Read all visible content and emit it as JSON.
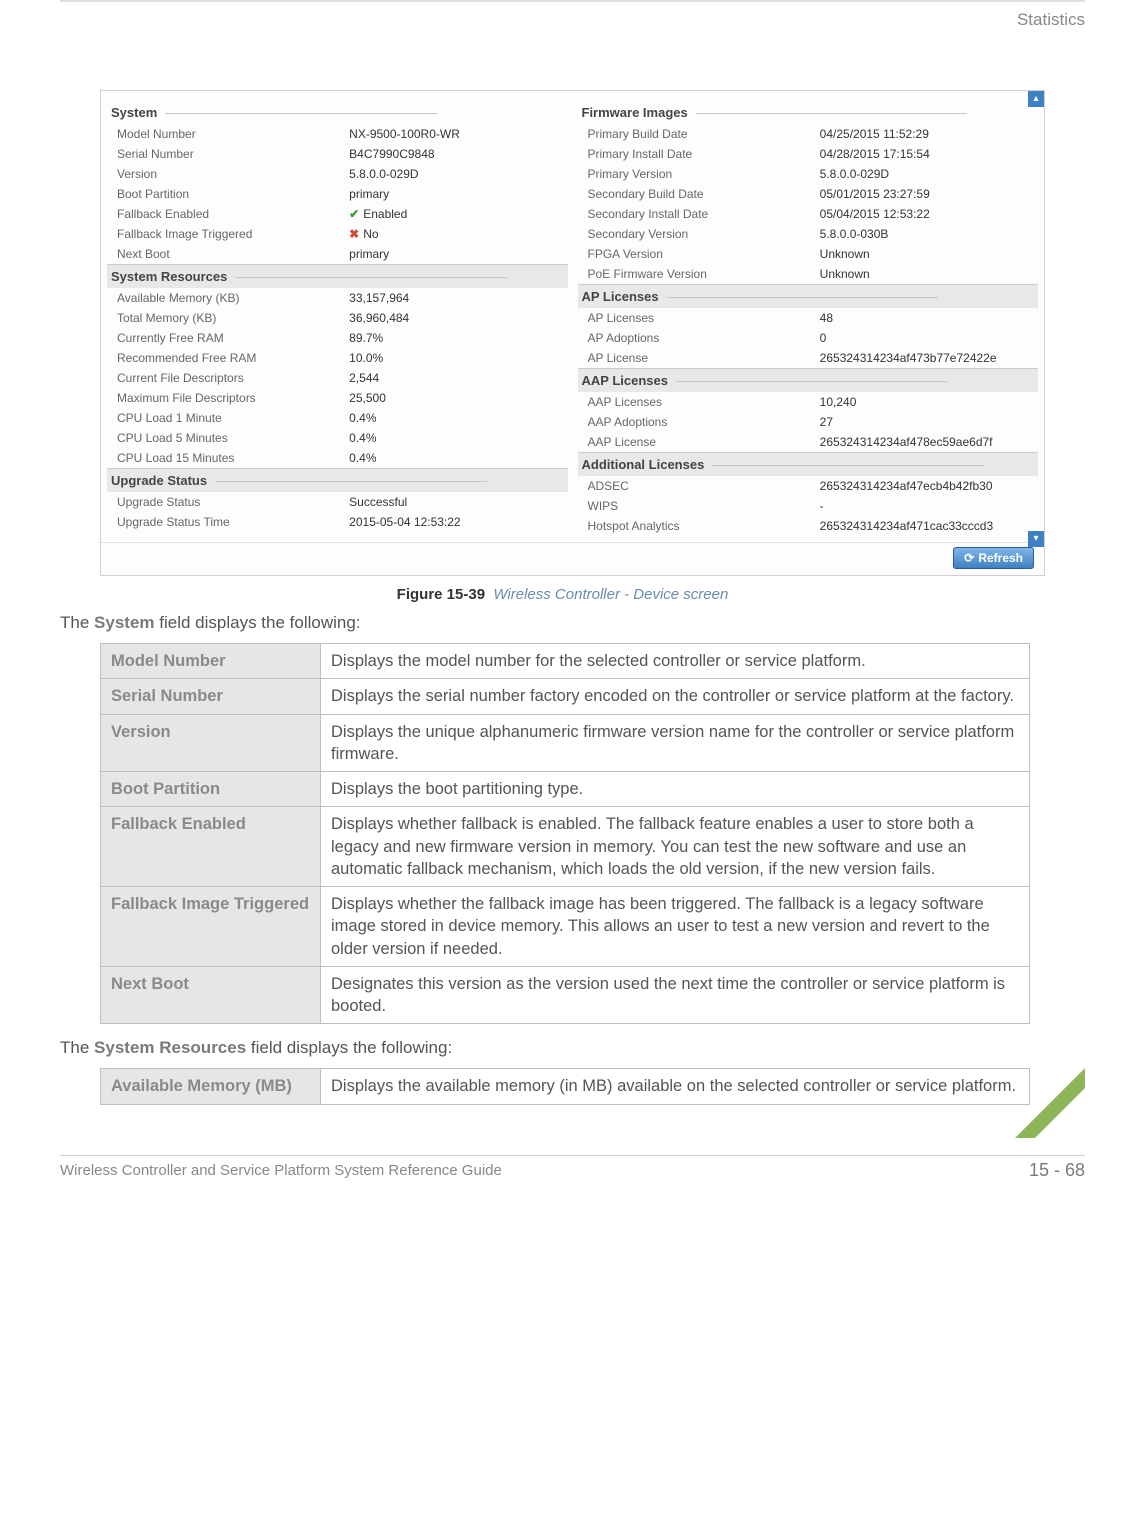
{
  "header": {
    "breadcrumb": "Statistics"
  },
  "screenshot": {
    "left": {
      "system": {
        "title": "System",
        "rows": [
          {
            "k": "Model Number",
            "v": "NX-9500-100R0-WR"
          },
          {
            "k": "Serial Number",
            "v": "B4C7990C9848"
          },
          {
            "k": "Version",
            "v": "5.8.0.0-029D"
          },
          {
            "k": "Boot Partition",
            "v": "primary"
          },
          {
            "k": "Fallback Enabled",
            "v": "Enabled",
            "icon": "check"
          },
          {
            "k": "Fallback Image Triggered",
            "v": "No",
            "icon": "x"
          },
          {
            "k": "Next Boot",
            "v": "primary"
          }
        ]
      },
      "resources": {
        "title": "System Resources",
        "rows": [
          {
            "k": "Available Memory (KB)",
            "v": "33,157,964"
          },
          {
            "k": "Total Memory (KB)",
            "v": "36,960,484"
          },
          {
            "k": "Currently Free RAM",
            "v": "89.7%"
          },
          {
            "k": "Recommended Free RAM",
            "v": "10.0%"
          },
          {
            "k": "Current File Descriptors",
            "v": "2,544"
          },
          {
            "k": "Maximum File Descriptors",
            "v": "25,500"
          },
          {
            "k": "CPU Load 1 Minute",
            "v": "0.4%"
          },
          {
            "k": "CPU Load 5 Minutes",
            "v": "0.4%"
          },
          {
            "k": "CPU Load 15 Minutes",
            "v": "0.4%"
          }
        ]
      },
      "upgrade": {
        "title": "Upgrade Status",
        "rows": [
          {
            "k": "Upgrade Status",
            "v": "Successful"
          },
          {
            "k": "Upgrade Status Time",
            "v": "2015-05-04 12:53:22"
          }
        ]
      }
    },
    "right": {
      "firmware": {
        "title": "Firmware Images",
        "rows": [
          {
            "k": "Primary Build Date",
            "v": "04/25/2015 11:52:29"
          },
          {
            "k": "Primary Install Date",
            "v": "04/28/2015 17:15:54"
          },
          {
            "k": "Primary Version",
            "v": "5.8.0.0-029D"
          },
          {
            "k": "Secondary Build Date",
            "v": "05/01/2015 23:27:59"
          },
          {
            "k": "Secondary Install Date",
            "v": "05/04/2015 12:53:22"
          },
          {
            "k": "Secondary Version",
            "v": "5.8.0.0-030B"
          },
          {
            "k": "FPGA Version",
            "v": "Unknown"
          },
          {
            "k": "PoE Firmware Version",
            "v": "Unknown"
          }
        ]
      },
      "ap": {
        "title": "AP Licenses",
        "rows": [
          {
            "k": "AP Licenses",
            "v": "48"
          },
          {
            "k": "AP Adoptions",
            "v": "0"
          },
          {
            "k": "AP License",
            "v": "265324314234af473b77e72422e"
          }
        ]
      },
      "aap": {
        "title": "AAP Licenses",
        "rows": [
          {
            "k": "AAP Licenses",
            "v": "10,240"
          },
          {
            "k": "AAP Adoptions",
            "v": "27"
          },
          {
            "k": "AAP License",
            "v": "265324314234af478ec59ae6d7f"
          }
        ]
      },
      "addl": {
        "title": "Additional Licenses",
        "rows": [
          {
            "k": "ADSEC",
            "v": "265324314234af47ecb4b42fb30"
          },
          {
            "k": "WIPS",
            "v": "-"
          },
          {
            "k": "Hotspot Analytics",
            "v": "265324314234af471cac33cccd3"
          }
        ]
      }
    },
    "refresh_label": "Refresh"
  },
  "figure": {
    "num": "Figure 15-39",
    "title": "Wireless Controller - Device screen"
  },
  "intro1_pre": "The ",
  "intro1_strong": "System",
  "intro1_post": " field displays the following:",
  "table1": [
    {
      "term": "Model Number",
      "desc": "Displays the model number for the selected controller or service platform."
    },
    {
      "term": "Serial Number",
      "desc": "Displays the serial number factory encoded on the controller or service platform at the factory."
    },
    {
      "term": "Version",
      "desc": "Displays the unique alphanumeric firmware version name for the controller or service platform firmware."
    },
    {
      "term": "Boot Partition",
      "desc": "Displays the boot partitioning type."
    },
    {
      "term": "Fallback Enabled",
      "desc": "Displays whether fallback is enabled. The fallback feature enables a user to store both a legacy and new firmware version in memory. You can test the new software and use an automatic fallback mechanism, which loads the old version, if the new version fails."
    },
    {
      "term": "Fallback Image Triggered",
      "desc": "Displays whether the fallback image has been triggered. The fallback is a legacy software image stored in device memory. This allows an user to test a new version and revert to the older version if needed."
    },
    {
      "term": "Next Boot",
      "desc": "Designates this version as the version used the next time the controller or service platform is booted."
    }
  ],
  "intro2_pre": "The ",
  "intro2_strong": "System Resources",
  "intro2_post": " field displays the following:",
  "table2": [
    {
      "term": "Available Memory (MB)",
      "desc": "Displays the available memory (in MB) available on the selected controller or service platform."
    }
  ],
  "footer": {
    "text": "Wireless Controller and Service Platform System Reference Guide",
    "page": "15 - 68"
  }
}
